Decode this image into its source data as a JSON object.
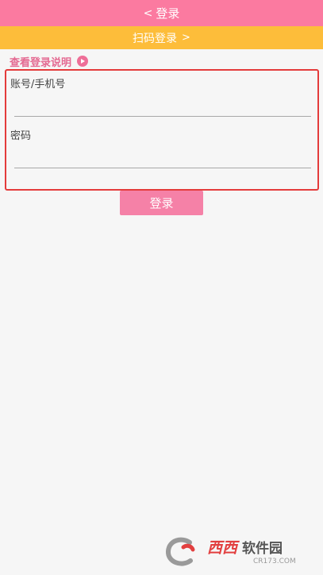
{
  "header": {
    "back_icon": "chevron-left-icon",
    "title": "登录"
  },
  "qr_login": {
    "label": "扫码登录",
    "icon": "chevron-right-icon"
  },
  "help": {
    "label": "查看登录说明",
    "icon": "play-circle-icon"
  },
  "form": {
    "account": {
      "label": "账号/手机号",
      "value": "",
      "placeholder": ""
    },
    "password": {
      "label": "密码",
      "value": "",
      "placeholder": ""
    }
  },
  "login_button": {
    "label": "登录"
  },
  "watermark": {
    "brand": "西西",
    "name": "软件园",
    "url": "CR173.COM"
  },
  "colors": {
    "header": "#fb7aa0",
    "qr_bar": "#fdbd3a",
    "accent_text": "#e46a92",
    "highlight_border": "#e43b3b",
    "button": "#f581a7"
  }
}
